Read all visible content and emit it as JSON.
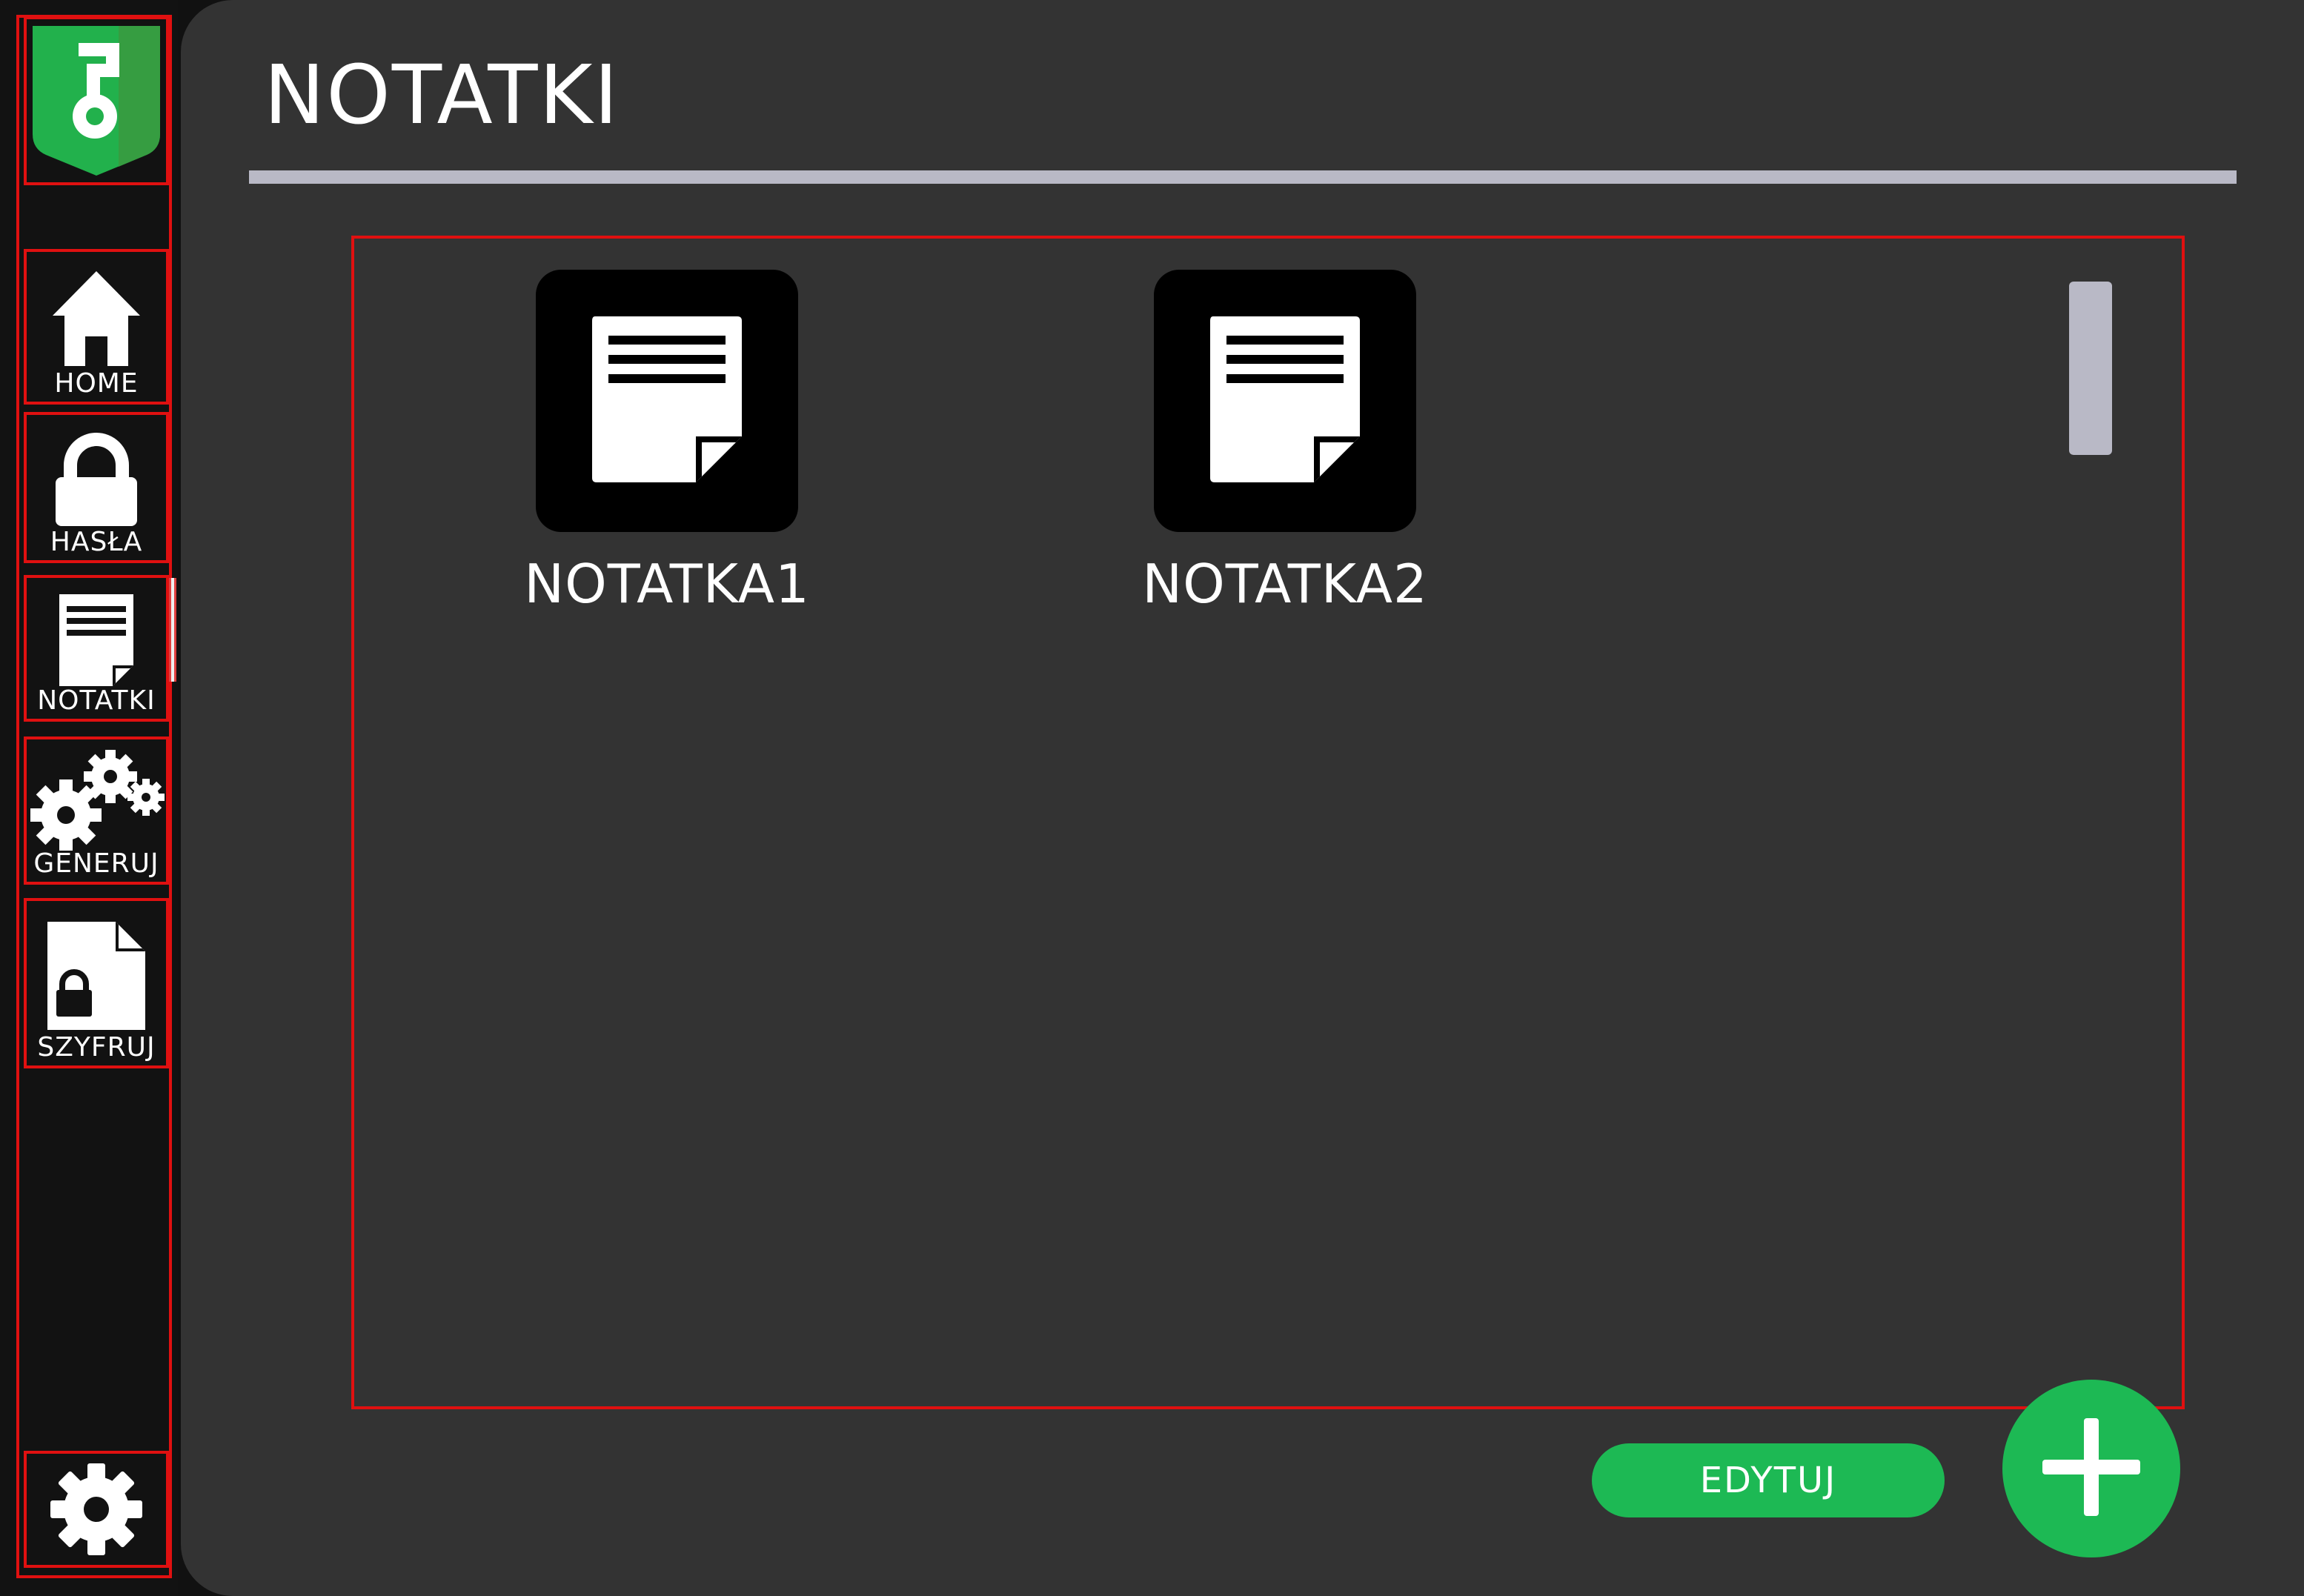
{
  "colors": {
    "accent": "#1db954",
    "background": "#333333",
    "sidebar": "#121212",
    "divider": "#b9b9c6",
    "highlight_outline": "#e01010"
  },
  "sidebar": {
    "logo_icon": "key-shield-logo-icon",
    "items": [
      {
        "label": "HOME",
        "icon": "home-icon"
      },
      {
        "label": "HASŁA",
        "icon": "lock-icon"
      },
      {
        "label": "NOTATKI",
        "icon": "note-icon",
        "active": true
      },
      {
        "label": "GENERUJ",
        "icon": "gears-icon"
      },
      {
        "label": "SZYFRUJ",
        "icon": "encrypt-file-icon"
      }
    ],
    "settings_icon": "gear-icon"
  },
  "main": {
    "title": "NOTATKI",
    "notes": [
      {
        "label": "NOTATKA1",
        "icon": "note-icon"
      },
      {
        "label": "NOTATKA2",
        "icon": "note-icon"
      }
    ],
    "edit_label": "EDYTUJ",
    "add_icon": "plus-icon"
  }
}
